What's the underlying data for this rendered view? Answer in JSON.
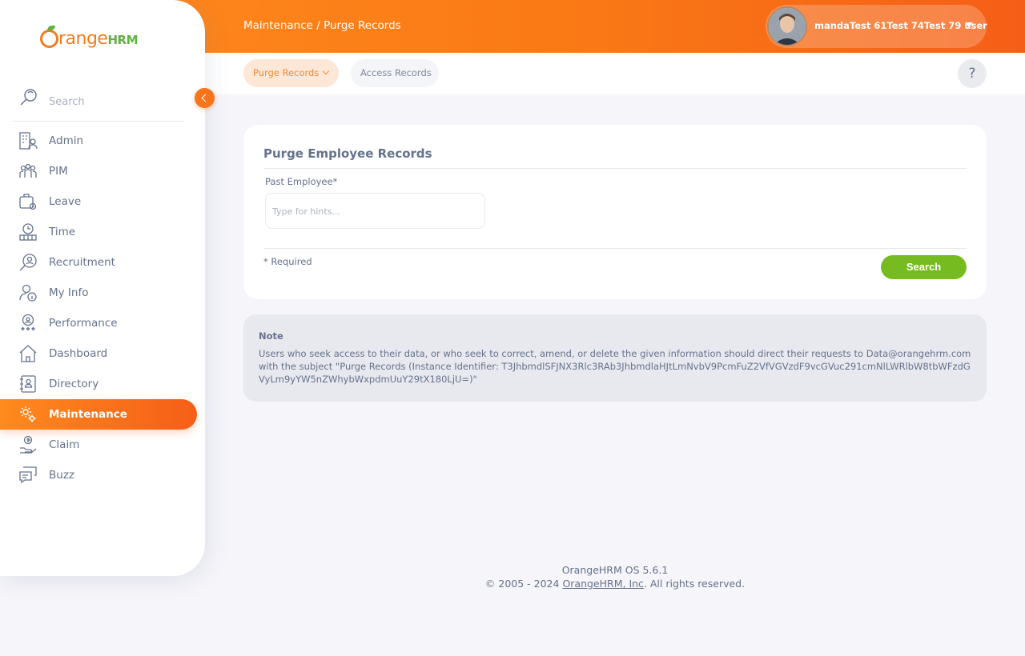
{
  "header": {
    "breadcrumb": "Maintenance / Purge Records",
    "user_name": "mandaTest 61Test 74Test 79 user"
  },
  "tabs": [
    {
      "label": "Purge Records",
      "active": true
    },
    {
      "label": "Access Records",
      "active": false
    }
  ],
  "help_label": "?",
  "sidebar": {
    "logo_text_main": "range",
    "logo_text_suffix": "HRM",
    "search_placeholder": "Search",
    "items": [
      {
        "label": "Admin",
        "icon": "admin-icon"
      },
      {
        "label": "PIM",
        "icon": "pim-icon"
      },
      {
        "label": "Leave",
        "icon": "leave-icon"
      },
      {
        "label": "Time",
        "icon": "time-icon"
      },
      {
        "label": "Recruitment",
        "icon": "recruitment-icon"
      },
      {
        "label": "My Info",
        "icon": "my-info-icon"
      },
      {
        "label": "Performance",
        "icon": "performance-icon"
      },
      {
        "label": "Dashboard",
        "icon": "dashboard-icon"
      },
      {
        "label": "Directory",
        "icon": "directory-icon"
      },
      {
        "label": "Maintenance",
        "icon": "maintenance-icon",
        "active": true
      },
      {
        "label": "Claim",
        "icon": "claim-icon"
      },
      {
        "label": "Buzz",
        "icon": "buzz-icon"
      }
    ]
  },
  "form": {
    "title": "Purge Employee Records",
    "field_label": "Past Employee*",
    "field_placeholder": "Type for hints...",
    "required_note": "* Required",
    "search_button": "Search"
  },
  "note": {
    "title": "Note",
    "body": "Users who seek access to their data, or who seek to correct, amend, or delete the given information should direct their requests to Data@orangehrm.com with the subject \"Purge Records (Instance Identifier: T3JhbmdlSFJNX3Rlc3RAb3JhbmdlaHJtLmNvbV9PcmFuZ2VfVGVzdF9vcGVuc291cmNlLWRlbW8tbWFzdGVyLm9yYW5nZWhybWxpdmUuY29tX180LjU=)\""
  },
  "footer": {
    "version": "OrangeHRM OS 5.6.1",
    "copyright_prefix": "© 2005 - 2024 ",
    "company_link": "OrangeHRM, Inc",
    "copyright_suffix": ". All rights reserved."
  },
  "colors": {
    "accent": "#f47c20",
    "search_button": "#76bc21"
  }
}
